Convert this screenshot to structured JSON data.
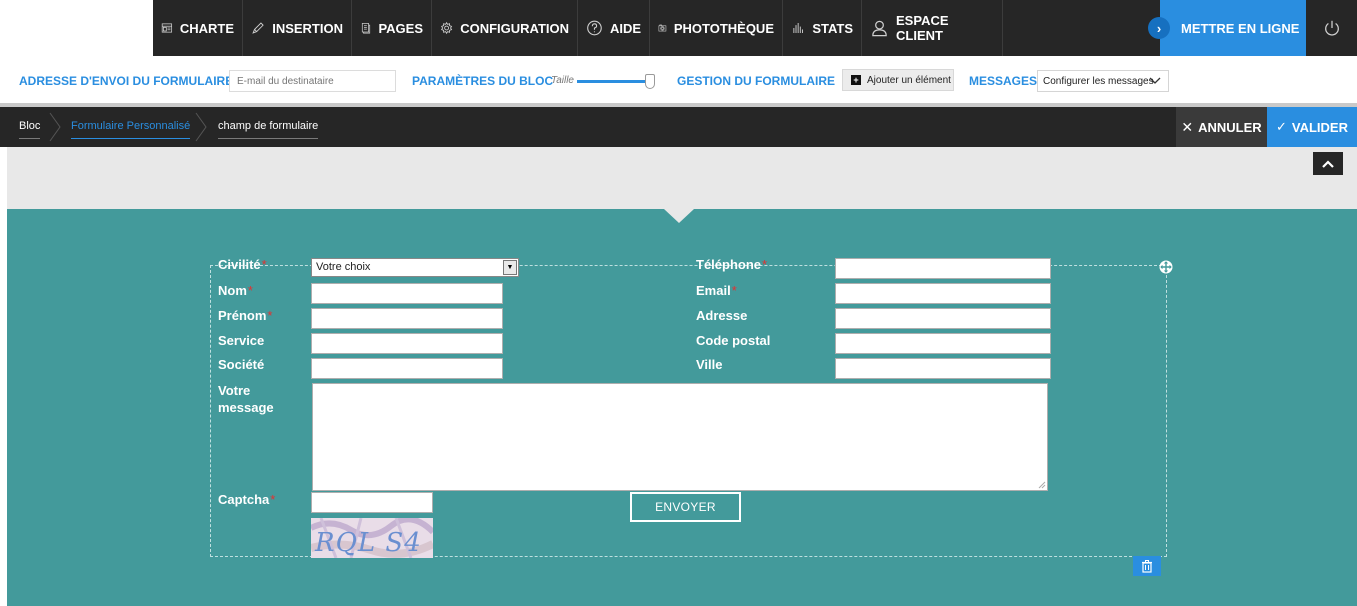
{
  "nav": {
    "items": [
      {
        "label": "CHARTE",
        "icon": "layout-icon"
      },
      {
        "label": "INSERTION",
        "icon": "pencil-icon"
      },
      {
        "label": "PAGES",
        "icon": "pages-icon"
      },
      {
        "label": "CONFIGURATION",
        "icon": "gear-icon"
      },
      {
        "label": "AIDE",
        "icon": "help-icon"
      },
      {
        "label": "PHOTOTHÈQUE",
        "icon": "camera-icon"
      },
      {
        "label": "STATS",
        "icon": "stats-icon"
      },
      {
        "label": "ESPACE CLIENT",
        "icon": "user-icon"
      }
    ],
    "publish_label": "METTRE EN LIGNE",
    "accent": "#2a8ee0"
  },
  "settings": {
    "email_label": "ADRESSE D'ENVOI DU FORMULAIRE :",
    "email_placeholder": "E-mail du destinataire",
    "block_params_label": "PARAMÈTRES DU BLOC",
    "size_label": "Taille",
    "form_manage_label": "GESTION DU FORMULAIRE",
    "add_element_label": "Ajouter un élément",
    "messages_label": "MESSAGES",
    "messages_select": "Configurer les messages"
  },
  "breadcrumb": {
    "items": [
      "Bloc",
      "Formulaire Personnalisé",
      "champ de formulaire"
    ],
    "cancel_label": "ANNULER",
    "validate_label": "VALIDER"
  },
  "form": {
    "civilite_label": "Civilité",
    "civilite_value": "Votre choix",
    "nom_label": "Nom",
    "prenom_label": "Prénom",
    "service_label": "Service",
    "societe_label": "Société",
    "message_label_1": "Votre",
    "message_label_2": "message",
    "telephone_label": "Téléphone",
    "email_label": "Email",
    "adresse_label": "Adresse",
    "cp_label": "Code postal",
    "ville_label": "Ville",
    "captcha_label": "Captcha",
    "captcha_text": "RQL S4",
    "send_label": "ENVOYER",
    "required_mark": "*"
  },
  "colors": {
    "teal": "#439a9b",
    "dark": "#262626",
    "required": "#e53030"
  }
}
